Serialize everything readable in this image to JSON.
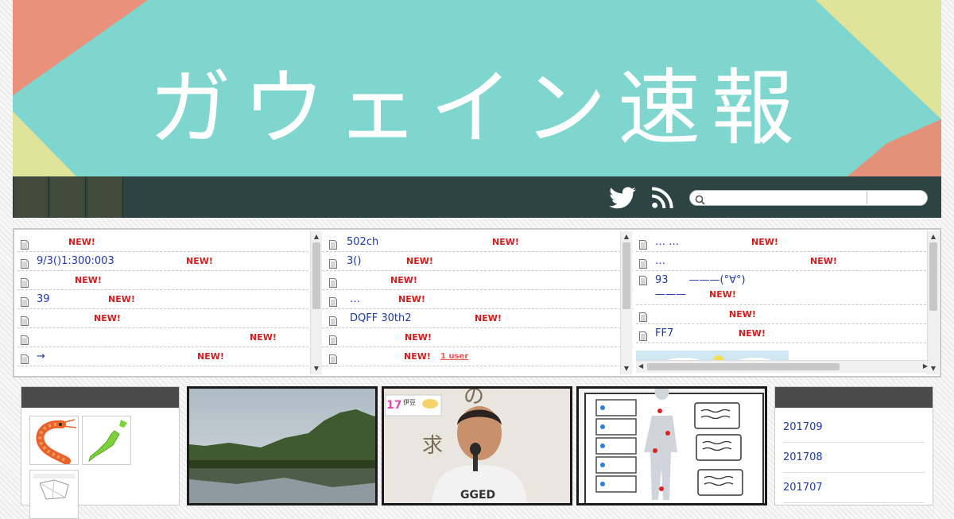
{
  "banner": {
    "title": "ガウェイン速報"
  },
  "nav": {
    "tabs": [
      "",
      "",
      ""
    ],
    "icons": [
      "twitter-icon",
      "rss-icon"
    ],
    "search": {
      "value": "",
      "placeholder": ""
    }
  },
  "antenna": {
    "columns": [
      [
        {
          "title": "",
          "badge": "NEW!"
        },
        {
          "title": "9/3()1:300:003",
          "badge": "NEW!"
        },
        {
          "title": "",
          "badge": "NEW!"
        },
        {
          "title": "39",
          "badge": "NEW!"
        },
        {
          "title": "",
          "badge": "NEW!"
        },
        {
          "title": "",
          "badge": "NEW!"
        },
        {
          "title": "→",
          "badge": "NEW!"
        }
      ],
      [
        {
          "title": "502ch",
          "badge": "NEW!"
        },
        {
          "title": "3()",
          "badge": "NEW!"
        },
        {
          "title": "",
          "badge": "NEW!"
        },
        {
          "title": "…",
          "badge": "NEW!"
        },
        {
          "title": "DQFF 30th2",
          "badge": "NEW!"
        },
        {
          "title": "",
          "badge": "NEW!"
        },
        {
          "title": "",
          "badge": "NEW!",
          "extra": "1 user"
        }
      ],
      [
        {
          "title": "… …",
          "badge": "NEW!"
        },
        {
          "title": "…",
          "badge": "NEW!"
        },
        {
          "title": "93　　———(°∀°)———",
          "badge": "NEW!"
        },
        {
          "title": "",
          "badge": "NEW!"
        },
        {
          "title": "FF7",
          "badge": "NEW!"
        }
      ]
    ]
  },
  "archives": [
    "201709",
    "201708",
    "201707"
  ],
  "colors": {
    "banner_bg": "#7fd6cf",
    "nav_bg": "#2d4445",
    "new_badge": "#d11d1d",
    "link": "#1f3aa3"
  }
}
